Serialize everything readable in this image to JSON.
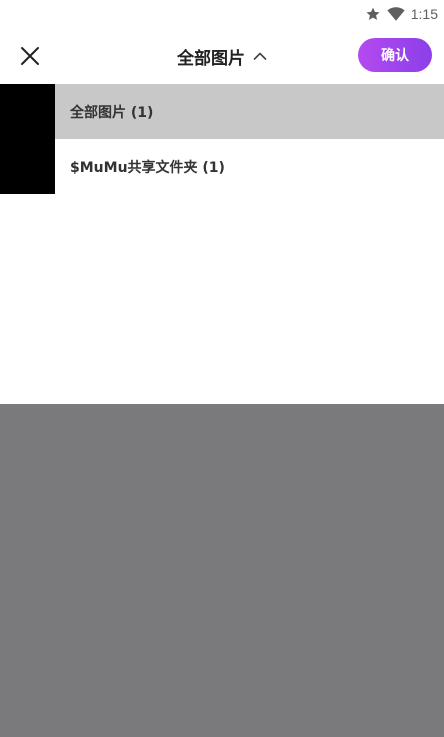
{
  "status_bar": {
    "time": "1:15",
    "icons": [
      "star-icon",
      "wifi-icon"
    ]
  },
  "header": {
    "close_icon": "close-icon",
    "title": "全部图片",
    "chevron_icon": "chevron-up-icon",
    "confirm_label": "确认",
    "confirm_colors": [
      "#b44af0",
      "#8b3fe9"
    ]
  },
  "dropdown": {
    "items": [
      {
        "label": "全部图片 (1)",
        "selected": true
      },
      {
        "label": "$MuMu共享文件夹 (1)",
        "selected": false
      }
    ],
    "selected_bg": "#c8c8c8"
  },
  "overlay": {
    "color": "#7a7a7c"
  }
}
